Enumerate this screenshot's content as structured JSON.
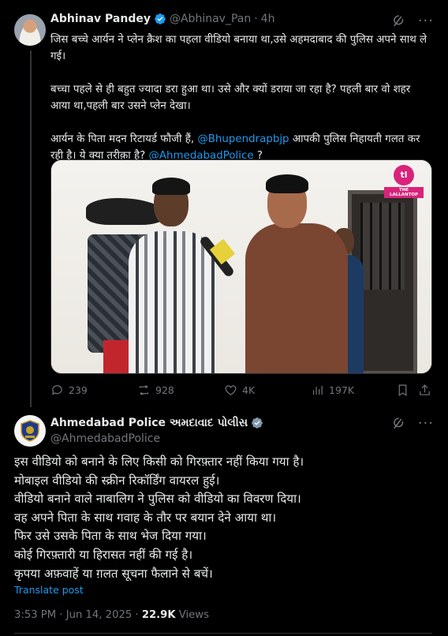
{
  "tweet1": {
    "author_name": "Abhinav Pandey",
    "handle": "@Abhinav_Pan",
    "time_sep": "·",
    "time": "4h",
    "paragraphs": [
      "जिस बच्चे आर्यन ने प्लेन क्रैश का पहला वीडियो बनाया था,उसे अहमदाबाद की पुलिस अपने साथ ले गई।",
      "बच्चा पहले से ही बहुत ज्यादा डरा हुआ था। उसे और क्यों डराया जा रहा है? पहली बार वो शहर आया था,पहली बार उसने प्लेन देखा।"
    ],
    "p3_pre": "आर्यन के पिता मदन रिटायर्ड फौजी हैं, ",
    "p3_mention1": "@Bhupendrapbjp",
    "p3_mid": " आपकी पुलिस निहायती गलत कर रही है। ये क्या तरीक़ा है? ",
    "p3_mention2": "@AhmedabadPolice",
    "p3_post": " ?",
    "media_logo_text": "tl",
    "media_logo_tag": "THE LALLANTOP",
    "replies": "239",
    "reposts": "928",
    "likes": "4K",
    "views": "197K"
  },
  "tweet2": {
    "author_name": "Ahmedabad Police અમદાવાદ પોલીસ",
    "handle": "@AhmedabadPolice",
    "lines": [
      "इस वीडियो को बनाने के लिए किसी को गिरफ़्तार नहीं किया गया है।",
      "मोबाइल वीडियो की स्क्रीन रिकॉर्डिंग वायरल हुई।",
      "वीडियो बनाने वाले नाबालिग ने पुलिस को वीडियो का विवरण दिया।",
      "वह अपने पिता के साथ गवाह के तौर पर बयान देने आया था।",
      "फिर उसे उसके पिता के साथ भेज दिया गया।",
      "कोई गिरफ़्तारी या हिरासत नहीं की गई है।",
      "कृपया अफ़वाहें या ग़लत सूचना फैलाने से बचें।"
    ],
    "translate": "Translate post",
    "time": "3:53 PM · Jun 14, 2025 · ",
    "views_count": "22.9K",
    "views_label": " Views"
  },
  "colors": {
    "accent": "#1d9bf0",
    "muted": "#71767b",
    "text": "#e7e9ea",
    "background": "#000000"
  }
}
